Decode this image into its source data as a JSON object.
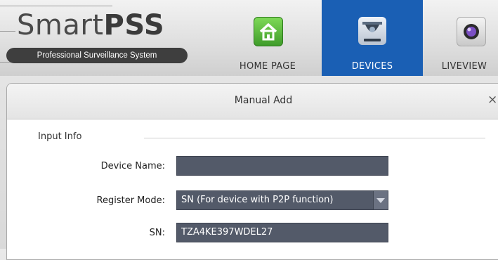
{
  "app": {
    "logo_title_regular": "Smart",
    "logo_title_bold": "PSS",
    "logo_subtitle": "Professional Surveillance System"
  },
  "nav": {
    "items": [
      {
        "label": "HOME PAGE",
        "icon": "home-icon",
        "active": false
      },
      {
        "label": "DEVICES",
        "icon": "devices-camera-icon",
        "active": true
      },
      {
        "label": "LIVEVIEW",
        "icon": "liveview-lens-icon",
        "active": false
      }
    ]
  },
  "dialog": {
    "title": "Manual Add",
    "close_label": "×",
    "section_title": "Input Info",
    "fields": {
      "device_name": {
        "label": "Device Name:",
        "value": ""
      },
      "register_mode": {
        "label": "Register Mode:",
        "value": "SN (For device with P2P function)"
      },
      "sn": {
        "label": "SN:",
        "value": "TZA4KE397WDEL27"
      }
    }
  },
  "colors": {
    "accent": "#1a5fb4",
    "field_bg": "#535a69",
    "home_icon": "#4caf3a"
  }
}
